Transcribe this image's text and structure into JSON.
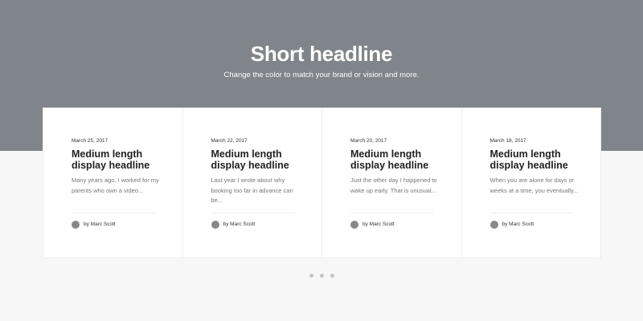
{
  "hero": {
    "title": "Short headline",
    "subtitle": "Change the color to match your brand or vision and more."
  },
  "cards": [
    {
      "date": "March 25, 2017",
      "title": "Medium length display headline",
      "excerpt": "Many years ago, I worked for my parents who own a video...",
      "author": "by Marc Scott"
    },
    {
      "date": "March 22, 2017",
      "title": "Medium length display headline",
      "excerpt": "Last year I wrote about why booking too far in advance can be...",
      "author": "by Marc Scott"
    },
    {
      "date": "March 20, 2017",
      "title": "Medium length display headline",
      "excerpt": "Just the other day I happened to wake up early. That is unusual...",
      "author": "by Marc Scott"
    },
    {
      "date": "March 18, 2017",
      "title": "Medium length display headline",
      "excerpt": "When you are alone for days or weeks at a time, you eventually...",
      "author": "by Marc Scott"
    }
  ],
  "pagination": {
    "total": 3
  },
  "colors": {
    "hero_bg": "#80858b",
    "page_bg": "#f7f7f7",
    "card_bg": "#ffffff",
    "dot": "#c5c5c5"
  }
}
